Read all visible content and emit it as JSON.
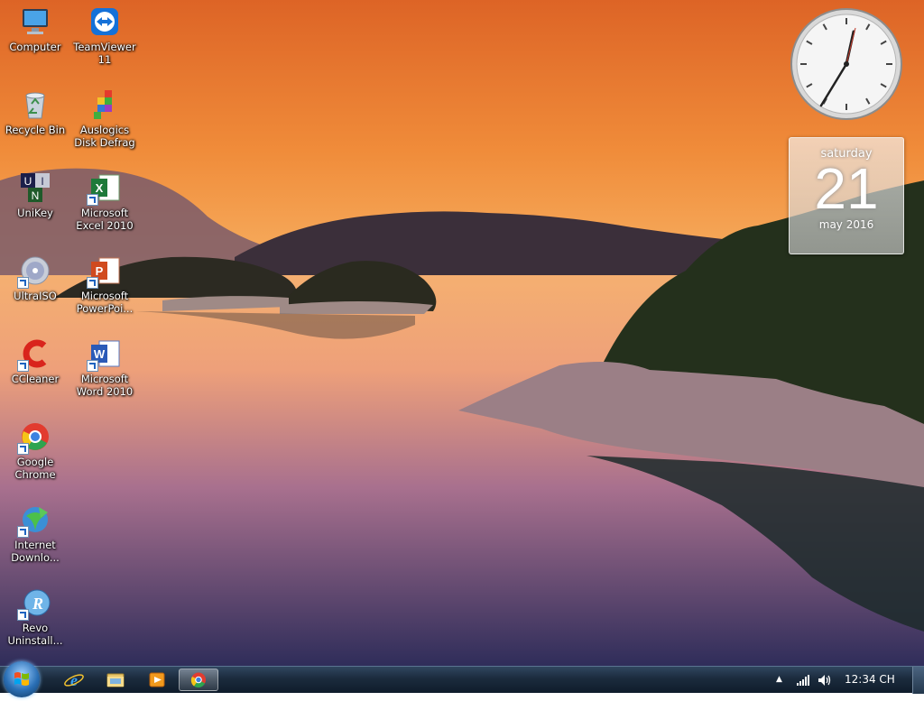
{
  "desktop_icons": [
    {
      "label": "Computer",
      "icon": "computer-icon"
    },
    {
      "label": "TeamViewer 11",
      "icon": "teamviewer-icon"
    },
    {
      "label": "Recycle Bin",
      "icon": "recycle-bin-icon"
    },
    {
      "label": "Auslogics Disk Defrag",
      "icon": "disk-defrag-icon"
    },
    {
      "label": "UniKey",
      "icon": "unikey-icon"
    },
    {
      "label": "Microsoft Excel 2010",
      "icon": "excel-icon"
    },
    {
      "label": "UltraISO",
      "icon": "ultraiso-icon"
    },
    {
      "label": "Microsoft PowerPoi...",
      "icon": "powerpoint-icon"
    },
    {
      "label": "CCleaner",
      "icon": "ccleaner-icon"
    },
    {
      "label": "Microsoft Word 2010",
      "icon": "word-icon"
    },
    {
      "label": "Google Chrome",
      "icon": "chrome-icon"
    },
    {
      "label": "Internet Downlo...",
      "icon": "idm-icon"
    },
    {
      "label": "Revo Uninstall...",
      "icon": "revo-uninstaller-icon"
    }
  ],
  "gadgets": {
    "calendar": {
      "day": "saturday",
      "date": "21",
      "month_year": "may 2016"
    }
  },
  "taskbar": {
    "pinned": [
      {
        "name": "internet-explorer",
        "icon": "ie-icon"
      },
      {
        "name": "windows-explorer",
        "icon": "folder-icon"
      },
      {
        "name": "media-player",
        "icon": "media-player-icon"
      },
      {
        "name": "google-chrome",
        "icon": "chrome-icon",
        "active": true
      }
    ],
    "tray": {
      "time": "12:34 CH"
    }
  },
  "colors": {
    "taskbar": "#1b2b3d",
    "sky_top": "#e06a2a",
    "sky_horizon": "#f6a04d",
    "water_bottom": "#2e2f5a"
  }
}
